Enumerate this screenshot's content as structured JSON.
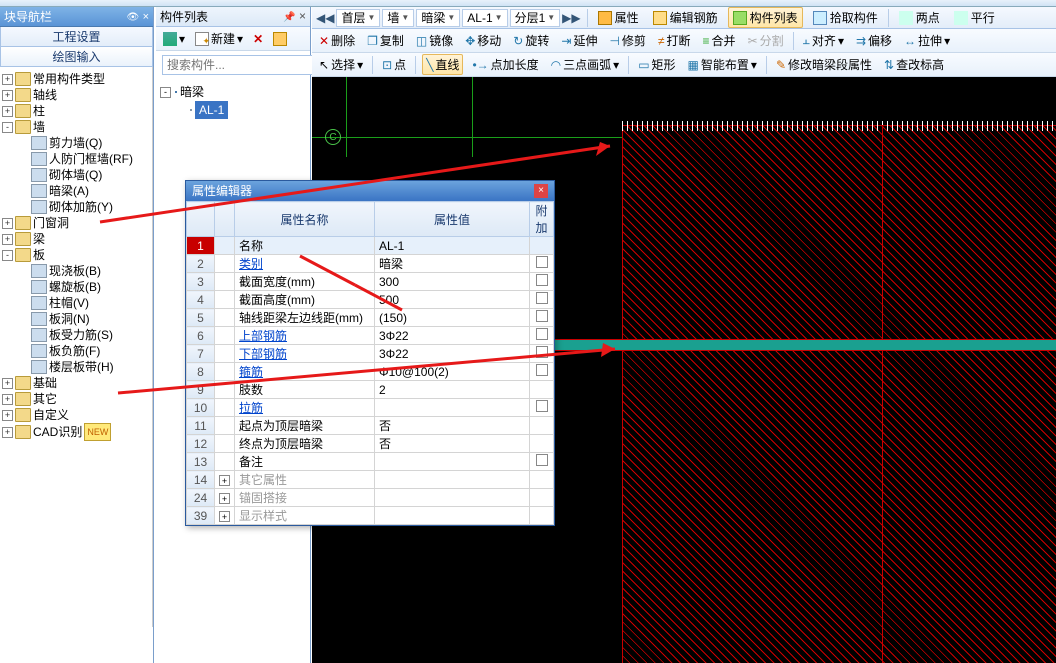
{
  "nav": {
    "title": "块导航栏",
    "tabs": {
      "t1": "工程设置",
      "t2": "绘图输入"
    },
    "tree": [
      {
        "lvl": 1,
        "exp": "+",
        "kind": "folder",
        "label": "常用构件类型"
      },
      {
        "lvl": 1,
        "exp": "+",
        "kind": "folder",
        "label": "轴线"
      },
      {
        "lvl": 1,
        "exp": "+",
        "kind": "folder",
        "label": "柱"
      },
      {
        "lvl": 1,
        "exp": "-",
        "kind": "folder",
        "label": "墙"
      },
      {
        "lvl": 2,
        "exp": "",
        "kind": "item",
        "label": "剪力墙(Q)"
      },
      {
        "lvl": 2,
        "exp": "",
        "kind": "item",
        "label": "人防门框墙(RF)"
      },
      {
        "lvl": 2,
        "exp": "",
        "kind": "item",
        "label": "砌体墙(Q)"
      },
      {
        "lvl": 2,
        "exp": "",
        "kind": "item",
        "label": "暗梁(A)"
      },
      {
        "lvl": 2,
        "exp": "",
        "kind": "item",
        "label": "砌体加筋(Y)"
      },
      {
        "lvl": 1,
        "exp": "+",
        "kind": "folder",
        "label": "门窗洞"
      },
      {
        "lvl": 1,
        "exp": "+",
        "kind": "folder",
        "label": "梁"
      },
      {
        "lvl": 1,
        "exp": "-",
        "kind": "folder",
        "label": "板"
      },
      {
        "lvl": 2,
        "exp": "",
        "kind": "item",
        "label": "现浇板(B)"
      },
      {
        "lvl": 2,
        "exp": "",
        "kind": "item",
        "label": "螺旋板(B)"
      },
      {
        "lvl": 2,
        "exp": "",
        "kind": "item",
        "label": "柱帽(V)"
      },
      {
        "lvl": 2,
        "exp": "",
        "kind": "item",
        "label": "板洞(N)"
      },
      {
        "lvl": 2,
        "exp": "",
        "kind": "item",
        "label": "板受力筋(S)"
      },
      {
        "lvl": 2,
        "exp": "",
        "kind": "item",
        "label": "板负筋(F)"
      },
      {
        "lvl": 2,
        "exp": "",
        "kind": "item",
        "label": "楼层板带(H)"
      },
      {
        "lvl": 1,
        "exp": "+",
        "kind": "folder",
        "label": "基础"
      },
      {
        "lvl": 1,
        "exp": "+",
        "kind": "folder",
        "label": "其它"
      },
      {
        "lvl": 1,
        "exp": "+",
        "kind": "folder",
        "label": "自定义"
      },
      {
        "lvl": 1,
        "exp": "+",
        "kind": "folder",
        "label": "CAD识别",
        "badge": "NEW"
      }
    ]
  },
  "comp": {
    "title": "构件列表",
    "new_btn": "新建",
    "search_placeholder": "搜索构件...",
    "root": "暗梁",
    "item": "AL-1"
  },
  "crumbs": {
    "c1": "首层",
    "c2": "墙",
    "c3": "暗梁",
    "c4": "AL-1",
    "c5": "分层1"
  },
  "attrbar": {
    "b1": "属性",
    "b2": "编辑钢筋",
    "b3": "构件列表",
    "b4": "拾取构件",
    "b5": "两点",
    "b6": "平行"
  },
  "tools1": {
    "t1": "删除",
    "t2": "复制",
    "t3": "镜像",
    "t4": "移动",
    "t5": "旋转",
    "t6": "延伸",
    "t7": "修剪",
    "t8": "打断",
    "t9": "合并",
    "t10": "分割",
    "t11": "对齐",
    "t12": "偏移",
    "t13": "拉伸"
  },
  "tools2": {
    "t1": "选择",
    "t2": "点",
    "t3": "直线",
    "t4": "点加长度",
    "t5": "三点画弧",
    "t6": "矩形",
    "t7": "智能布置",
    "t8": "修改暗梁段属性",
    "t9": "查改标高"
  },
  "axis_label": "C",
  "prop": {
    "title": "属性编辑器",
    "col_name": "属性名称",
    "col_val": "属性值",
    "col_add": "附加",
    "rows": [
      {
        "n": "1",
        "name": "名称",
        "val": "AL-1",
        "chk": false,
        "sel": true
      },
      {
        "n": "2",
        "name": "类别",
        "val": "暗梁",
        "chk": true,
        "link": true
      },
      {
        "n": "3",
        "name": "截面宽度(mm)",
        "val": "300",
        "chk": true
      },
      {
        "n": "4",
        "name": "截面高度(mm)",
        "val": "500",
        "chk": true
      },
      {
        "n": "5",
        "name": "轴线距梁左边线距(mm)",
        "val": "(150)",
        "chk": true
      },
      {
        "n": "6",
        "name": "上部钢筋",
        "val": "3Φ22",
        "chk": true,
        "link": true
      },
      {
        "n": "7",
        "name": "下部钢筋",
        "val": "3Φ22",
        "chk": true,
        "link": true
      },
      {
        "n": "8",
        "name": "箍筋",
        "val": "Φ10@100(2)",
        "chk": true,
        "link": true
      },
      {
        "n": "9",
        "name": "肢数",
        "val": "2",
        "chk": false
      },
      {
        "n": "10",
        "name": "拉筋",
        "val": "",
        "chk": true,
        "link": true
      },
      {
        "n": "11",
        "name": "起点为顶层暗梁",
        "val": "否",
        "chk": false
      },
      {
        "n": "12",
        "name": "终点为顶层暗梁",
        "val": "否",
        "chk": false
      },
      {
        "n": "13",
        "name": "备注",
        "val": "",
        "chk": true
      },
      {
        "n": "14",
        "name": "其它属性",
        "val": "",
        "exp": "+",
        "grey": true
      },
      {
        "n": "24",
        "name": "锚固搭接",
        "val": "",
        "exp": "+",
        "grey": true
      },
      {
        "n": "39",
        "name": "显示样式",
        "val": "",
        "exp": "+",
        "grey": true
      }
    ]
  }
}
